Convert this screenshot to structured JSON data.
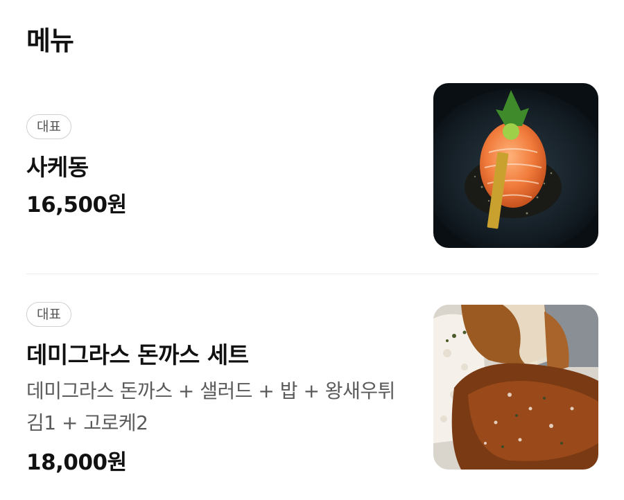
{
  "section": {
    "title": "메뉴"
  },
  "items": [
    {
      "badge": "대표",
      "name": "사케동",
      "description": "",
      "price": "16,500원",
      "image_icon": "salmon-rice-bowl-photo"
    },
    {
      "badge": "대표",
      "name": "데미그라스 돈까스 세트",
      "description": "데미그라스 돈까스 + 샐러드 + 밥 + 왕새우튀김1 + 고로케2",
      "price": "18,000원",
      "image_icon": "pork-cutlet-set-photo"
    }
  ]
}
